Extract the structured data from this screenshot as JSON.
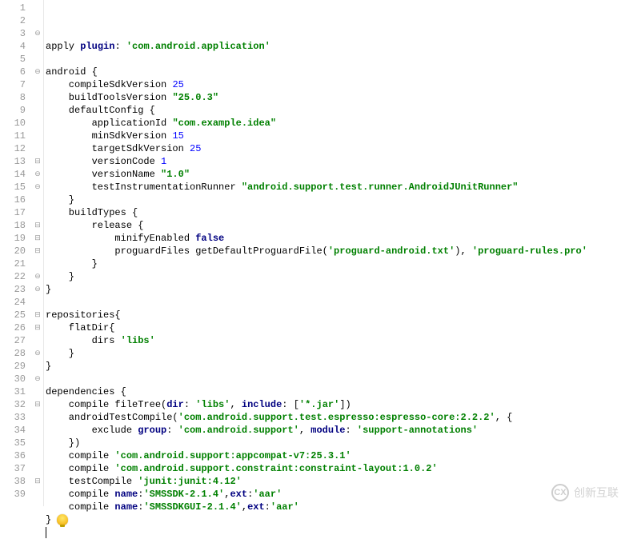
{
  "lines": [
    {
      "n": 1,
      "fold": "",
      "tokens": [
        [
          "ident",
          "apply "
        ],
        [
          "kw",
          "plugin"
        ],
        [
          "ident",
          ": "
        ],
        [
          "str",
          "'com.android.application'"
        ]
      ]
    },
    {
      "n": 2,
      "fold": "",
      "tokens": [
        [
          "ident",
          ""
        ]
      ]
    },
    {
      "n": 3,
      "fold": "⊖",
      "tokens": [
        [
          "ident",
          "android {"
        ]
      ]
    },
    {
      "n": 4,
      "fold": "",
      "tokens": [
        [
          "ident",
          "    compileSdkVersion "
        ],
        [
          "num",
          "25"
        ]
      ]
    },
    {
      "n": 5,
      "fold": "",
      "tokens": [
        [
          "ident",
          "    buildToolsVersion "
        ],
        [
          "str",
          "\"25.0.3\""
        ]
      ]
    },
    {
      "n": 6,
      "fold": "⊖",
      "tokens": [
        [
          "ident",
          "    defaultConfig {"
        ]
      ]
    },
    {
      "n": 7,
      "fold": "",
      "tokens": [
        [
          "ident",
          "        applicationId "
        ],
        [
          "str",
          "\"com.example.idea\""
        ]
      ]
    },
    {
      "n": 8,
      "fold": "",
      "tokens": [
        [
          "ident",
          "        minSdkVersion "
        ],
        [
          "num",
          "15"
        ]
      ]
    },
    {
      "n": 9,
      "fold": "",
      "tokens": [
        [
          "ident",
          "        targetSdkVersion "
        ],
        [
          "num",
          "25"
        ]
      ]
    },
    {
      "n": 10,
      "fold": "",
      "tokens": [
        [
          "ident",
          "        versionCode "
        ],
        [
          "num",
          "1"
        ]
      ]
    },
    {
      "n": 11,
      "fold": "",
      "tokens": [
        [
          "ident",
          "        versionName "
        ],
        [
          "str",
          "\"1.0\""
        ]
      ]
    },
    {
      "n": 12,
      "fold": "",
      "tokens": [
        [
          "ident",
          "        testInstrumentationRunner "
        ],
        [
          "str",
          "\"android.support.test.runner.AndroidJUnitRunner\""
        ]
      ]
    },
    {
      "n": 13,
      "fold": "⊟",
      "tokens": [
        [
          "ident",
          "    }"
        ]
      ]
    },
    {
      "n": 14,
      "fold": "⊖",
      "tokens": [
        [
          "ident",
          "    buildTypes {"
        ]
      ]
    },
    {
      "n": 15,
      "fold": "⊖",
      "tokens": [
        [
          "ident",
          "        release {"
        ]
      ]
    },
    {
      "n": 16,
      "fold": "",
      "tokens": [
        [
          "ident",
          "            minifyEnabled "
        ],
        [
          "kw",
          "false"
        ]
      ]
    },
    {
      "n": 17,
      "fold": "",
      "tokens": [
        [
          "ident",
          "            proguardFiles getDefaultProguardFile("
        ],
        [
          "str",
          "'proguard-android.txt'"
        ],
        [
          "ident",
          "), "
        ],
        [
          "str",
          "'proguard-rules.pro'"
        ]
      ]
    },
    {
      "n": 18,
      "fold": "⊟",
      "tokens": [
        [
          "ident",
          "        }"
        ]
      ]
    },
    {
      "n": 19,
      "fold": "⊟",
      "tokens": [
        [
          "ident",
          "    }"
        ]
      ]
    },
    {
      "n": 20,
      "fold": "⊟",
      "tokens": [
        [
          "ident",
          "}"
        ]
      ]
    },
    {
      "n": 21,
      "fold": "",
      "tokens": [
        [
          "ident",
          ""
        ]
      ]
    },
    {
      "n": 22,
      "fold": "⊖",
      "tokens": [
        [
          "ident",
          "repositories{"
        ]
      ]
    },
    {
      "n": 23,
      "fold": "⊖",
      "tokens": [
        [
          "ident",
          "    flatDir{"
        ]
      ]
    },
    {
      "n": 24,
      "fold": "",
      "tokens": [
        [
          "ident",
          "        dirs "
        ],
        [
          "str",
          "'libs'"
        ]
      ]
    },
    {
      "n": 25,
      "fold": "⊟",
      "tokens": [
        [
          "ident",
          "    }"
        ]
      ]
    },
    {
      "n": 26,
      "fold": "⊟",
      "tokens": [
        [
          "ident",
          "}"
        ]
      ]
    },
    {
      "n": 27,
      "fold": "",
      "tokens": [
        [
          "ident",
          ""
        ]
      ]
    },
    {
      "n": 28,
      "fold": "⊖",
      "tokens": [
        [
          "ident",
          "dependencies {"
        ]
      ]
    },
    {
      "n": 29,
      "fold": "",
      "tokens": [
        [
          "ident",
          "    compile fileTree("
        ],
        [
          "kw",
          "dir"
        ],
        [
          "ident",
          ": "
        ],
        [
          "str",
          "'libs'"
        ],
        [
          "ident",
          ", "
        ],
        [
          "kw",
          "include"
        ],
        [
          "ident",
          ": ["
        ],
        [
          "str",
          "'*.jar'"
        ],
        [
          "ident",
          "])"
        ]
      ]
    },
    {
      "n": 30,
      "fold": "⊖",
      "tokens": [
        [
          "ident",
          "    androidTestCompile("
        ],
        [
          "str",
          "'com.android.support.test.espresso:espresso-core:2.2.2'"
        ],
        [
          "ident",
          ", {"
        ]
      ]
    },
    {
      "n": 31,
      "fold": "",
      "tokens": [
        [
          "ident",
          "        exclude "
        ],
        [
          "kw",
          "group"
        ],
        [
          "ident",
          ": "
        ],
        [
          "str",
          "'com.android.support'"
        ],
        [
          "ident",
          ", "
        ],
        [
          "kw",
          "module"
        ],
        [
          "ident",
          ": "
        ],
        [
          "str",
          "'support-annotations'"
        ]
      ]
    },
    {
      "n": 32,
      "fold": "⊟",
      "tokens": [
        [
          "ident",
          "    })"
        ]
      ]
    },
    {
      "n": 33,
      "fold": "",
      "tokens": [
        [
          "ident",
          "    compile "
        ],
        [
          "str",
          "'com.android.support:appcompat-v7:25.3.1'"
        ]
      ]
    },
    {
      "n": 34,
      "fold": "",
      "tokens": [
        [
          "ident",
          "    compile "
        ],
        [
          "str",
          "'com.android.support.constraint:constraint-layout:1.0.2'"
        ]
      ]
    },
    {
      "n": 35,
      "fold": "",
      "tokens": [
        [
          "ident",
          "    testCompile "
        ],
        [
          "str",
          "'junit:junit:4.12'"
        ]
      ]
    },
    {
      "n": 36,
      "fold": "",
      "tokens": [
        [
          "ident",
          "    compile "
        ],
        [
          "kw",
          "name"
        ],
        [
          "ident",
          ":"
        ],
        [
          "str",
          "'SMSSDK-2.1.4'"
        ],
        [
          "ident",
          ","
        ],
        [
          "kw",
          "ext"
        ],
        [
          "ident",
          ":"
        ],
        [
          "str",
          "'aar'"
        ]
      ]
    },
    {
      "n": 37,
      "fold": "",
      "tokens": [
        [
          "ident",
          "    compile "
        ],
        [
          "kw",
          "name"
        ],
        [
          "ident",
          ":"
        ],
        [
          "str",
          "'SMSSDKGUI-2.1.4'"
        ],
        [
          "ident",
          ","
        ],
        [
          "kw",
          "ext"
        ],
        [
          "ident",
          ":"
        ],
        [
          "str",
          "'aar'"
        ]
      ]
    },
    {
      "n": 38,
      "fold": "⊟",
      "tokens": [
        [
          "ident",
          "}"
        ],
        [
          "bulb",
          ""
        ]
      ]
    },
    {
      "n": 39,
      "fold": "",
      "tokens": [
        [
          "caret",
          ""
        ]
      ]
    }
  ],
  "watermark": {
    "text": "创新互联",
    "icon": "CX"
  }
}
